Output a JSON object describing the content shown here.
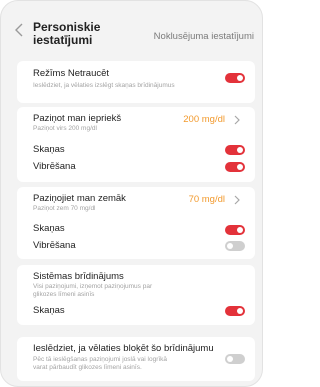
{
  "header": {
    "title": "Personiskie iestatījumi",
    "defaults_link": "Noklusējuma iestatījumi"
  },
  "urgent_low": {
    "label": "Režīms Netraucēt",
    "description": "Ieslēdziet, ja vēlaties izslēgt skaņas brīdinājumus",
    "toggle": true
  },
  "high_alert": {
    "label": "Paziņot man iepriekš",
    "sub": "Paziņot virs 200 mg/dl",
    "value": "200 mg/dl",
    "sound_label": "Skaņas",
    "sound_toggle": true,
    "vibration_label": "Vibrēšana",
    "vibration_toggle": true
  },
  "low_alert": {
    "label": "Paziņojiet man zemāk",
    "sub": "Paziņot zem 70 mg/dl",
    "value": "70 mg/dl",
    "sound_label": "Skaņas",
    "sound_toggle": true,
    "vibration_label": "Vibrēšana",
    "vibration_toggle": false
  },
  "system_alert": {
    "label": "Sistēmas brīdinājums",
    "sub_line1": "Visi paziņojumi, izņemot paziņojumus par",
    "sub_line2": "glikozes līmeni asinīs",
    "sound_label": "Skaņas",
    "sound_toggle": true
  },
  "block_alert": {
    "label": "Ieslēdziet, ja vēlaties bloķēt šo brīdinājumu",
    "sub_line1": "Pēc tā ieslēgšanas paziņojumi joslā vai logrīkā",
    "sub_line2": "varat pārbaudīt glikozes līmeni asinīs.",
    "toggle": false
  },
  "colors": {
    "accent_on": "#e3323a",
    "toggle_off": "#cfcfcf",
    "value_orange": "#f29a2e"
  },
  "icons": {
    "back": "chevron-left-icon",
    "row_arrow": "chevron-right-icon"
  }
}
